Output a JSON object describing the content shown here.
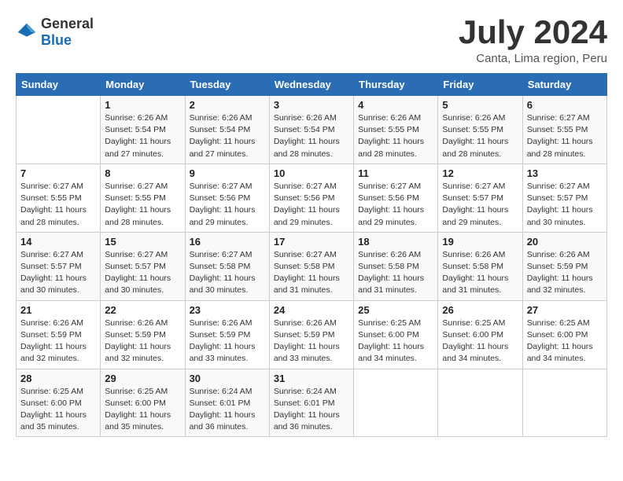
{
  "header": {
    "logo_general": "General",
    "logo_blue": "Blue",
    "month_title": "July 2024",
    "location": "Canta, Lima region, Peru"
  },
  "weekdays": [
    "Sunday",
    "Monday",
    "Tuesday",
    "Wednesday",
    "Thursday",
    "Friday",
    "Saturday"
  ],
  "weeks": [
    [
      {
        "day": "",
        "info": ""
      },
      {
        "day": "1",
        "info": "Sunrise: 6:26 AM\nSunset: 5:54 PM\nDaylight: 11 hours and 27 minutes."
      },
      {
        "day": "2",
        "info": "Sunrise: 6:26 AM\nSunset: 5:54 PM\nDaylight: 11 hours and 27 minutes."
      },
      {
        "day": "3",
        "info": "Sunrise: 6:26 AM\nSunset: 5:54 PM\nDaylight: 11 hours and 28 minutes."
      },
      {
        "day": "4",
        "info": "Sunrise: 6:26 AM\nSunset: 5:55 PM\nDaylight: 11 hours and 28 minutes."
      },
      {
        "day": "5",
        "info": "Sunrise: 6:26 AM\nSunset: 5:55 PM\nDaylight: 11 hours and 28 minutes."
      },
      {
        "day": "6",
        "info": "Sunrise: 6:27 AM\nSunset: 5:55 PM\nDaylight: 11 hours and 28 minutes."
      }
    ],
    [
      {
        "day": "7",
        "info": "Sunrise: 6:27 AM\nSunset: 5:55 PM\nDaylight: 11 hours and 28 minutes."
      },
      {
        "day": "8",
        "info": "Sunrise: 6:27 AM\nSunset: 5:55 PM\nDaylight: 11 hours and 28 minutes."
      },
      {
        "day": "9",
        "info": "Sunrise: 6:27 AM\nSunset: 5:56 PM\nDaylight: 11 hours and 29 minutes."
      },
      {
        "day": "10",
        "info": "Sunrise: 6:27 AM\nSunset: 5:56 PM\nDaylight: 11 hours and 29 minutes."
      },
      {
        "day": "11",
        "info": "Sunrise: 6:27 AM\nSunset: 5:56 PM\nDaylight: 11 hours and 29 minutes."
      },
      {
        "day": "12",
        "info": "Sunrise: 6:27 AM\nSunset: 5:57 PM\nDaylight: 11 hours and 29 minutes."
      },
      {
        "day": "13",
        "info": "Sunrise: 6:27 AM\nSunset: 5:57 PM\nDaylight: 11 hours and 30 minutes."
      }
    ],
    [
      {
        "day": "14",
        "info": "Sunrise: 6:27 AM\nSunset: 5:57 PM\nDaylight: 11 hours and 30 minutes."
      },
      {
        "day": "15",
        "info": "Sunrise: 6:27 AM\nSunset: 5:57 PM\nDaylight: 11 hours and 30 minutes."
      },
      {
        "day": "16",
        "info": "Sunrise: 6:27 AM\nSunset: 5:58 PM\nDaylight: 11 hours and 30 minutes."
      },
      {
        "day": "17",
        "info": "Sunrise: 6:27 AM\nSunset: 5:58 PM\nDaylight: 11 hours and 31 minutes."
      },
      {
        "day": "18",
        "info": "Sunrise: 6:26 AM\nSunset: 5:58 PM\nDaylight: 11 hours and 31 minutes."
      },
      {
        "day": "19",
        "info": "Sunrise: 6:26 AM\nSunset: 5:58 PM\nDaylight: 11 hours and 31 minutes."
      },
      {
        "day": "20",
        "info": "Sunrise: 6:26 AM\nSunset: 5:59 PM\nDaylight: 11 hours and 32 minutes."
      }
    ],
    [
      {
        "day": "21",
        "info": "Sunrise: 6:26 AM\nSunset: 5:59 PM\nDaylight: 11 hours and 32 minutes."
      },
      {
        "day": "22",
        "info": "Sunrise: 6:26 AM\nSunset: 5:59 PM\nDaylight: 11 hours and 32 minutes."
      },
      {
        "day": "23",
        "info": "Sunrise: 6:26 AM\nSunset: 5:59 PM\nDaylight: 11 hours and 33 minutes."
      },
      {
        "day": "24",
        "info": "Sunrise: 6:26 AM\nSunset: 5:59 PM\nDaylight: 11 hours and 33 minutes."
      },
      {
        "day": "25",
        "info": "Sunrise: 6:25 AM\nSunset: 6:00 PM\nDaylight: 11 hours and 34 minutes."
      },
      {
        "day": "26",
        "info": "Sunrise: 6:25 AM\nSunset: 6:00 PM\nDaylight: 11 hours and 34 minutes."
      },
      {
        "day": "27",
        "info": "Sunrise: 6:25 AM\nSunset: 6:00 PM\nDaylight: 11 hours and 34 minutes."
      }
    ],
    [
      {
        "day": "28",
        "info": "Sunrise: 6:25 AM\nSunset: 6:00 PM\nDaylight: 11 hours and 35 minutes."
      },
      {
        "day": "29",
        "info": "Sunrise: 6:25 AM\nSunset: 6:00 PM\nDaylight: 11 hours and 35 minutes."
      },
      {
        "day": "30",
        "info": "Sunrise: 6:24 AM\nSunset: 6:01 PM\nDaylight: 11 hours and 36 minutes."
      },
      {
        "day": "31",
        "info": "Sunrise: 6:24 AM\nSunset: 6:01 PM\nDaylight: 11 hours and 36 minutes."
      },
      {
        "day": "",
        "info": ""
      },
      {
        "day": "",
        "info": ""
      },
      {
        "day": "",
        "info": ""
      }
    ]
  ]
}
